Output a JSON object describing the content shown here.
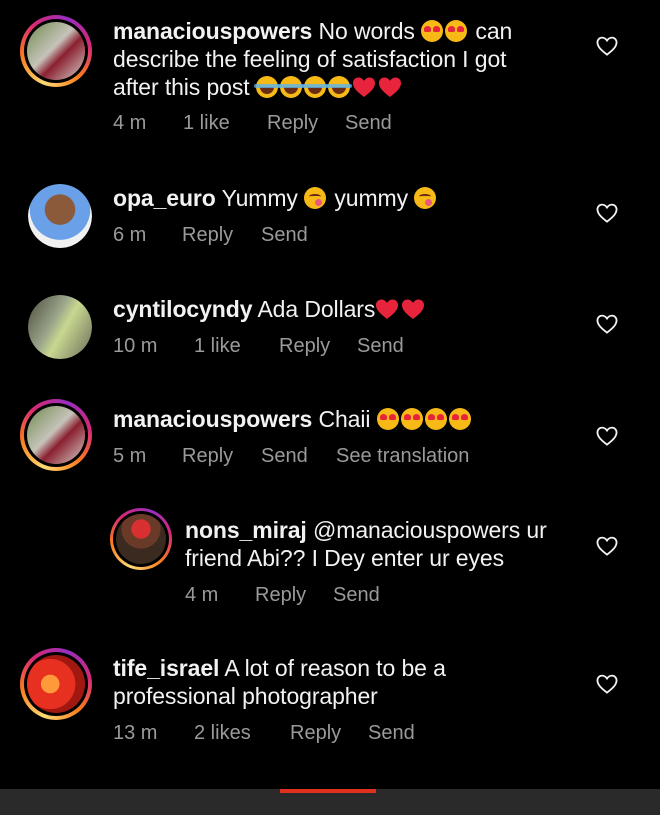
{
  "comments": [
    {
      "username": "manaciouspowers",
      "text_line1": "No words",
      "text_line1_tail": "can",
      "text_line2": "describe the feeling of satisfaction I got",
      "text_line3": "after this post",
      "time": "4 m",
      "likes": "1 like",
      "reply": "Reply",
      "send": "Send"
    },
    {
      "username": "opa_euro",
      "text_a": "Yummy",
      "text_b": "yummy",
      "time": "6 m",
      "reply": "Reply",
      "send": "Send"
    },
    {
      "username": "cyntilocyndy",
      "text": "Ada Dollars",
      "time": "10 m",
      "likes": "1 like",
      "reply": "Reply",
      "send": "Send"
    },
    {
      "username": "manaciouspowers",
      "text": "Chaii",
      "time": "5 m",
      "reply": "Reply",
      "send": "Send",
      "see_translation": "See translation"
    },
    {
      "username": "nons_miraj",
      "text_line1": "@manaciouspowers ur",
      "text_line2": "friend Abi?? I Dey enter ur eyes",
      "time": "4 m",
      "reply": "Reply",
      "send": "Send"
    },
    {
      "username": "tife_israel",
      "text_line1": "A lot of reason  to be a",
      "text_line2": "professional photographer",
      "time": "13 m",
      "likes": "2 likes",
      "reply": "Reply",
      "send": "Send"
    }
  ],
  "icons": {
    "like": "heart-outline-icon"
  },
  "colors": {
    "background": "#000000",
    "text": "#f2f2f2",
    "meta": "#9a9a9a",
    "story_ring": "#d62976",
    "bottom_accent": "#e0301e"
  }
}
